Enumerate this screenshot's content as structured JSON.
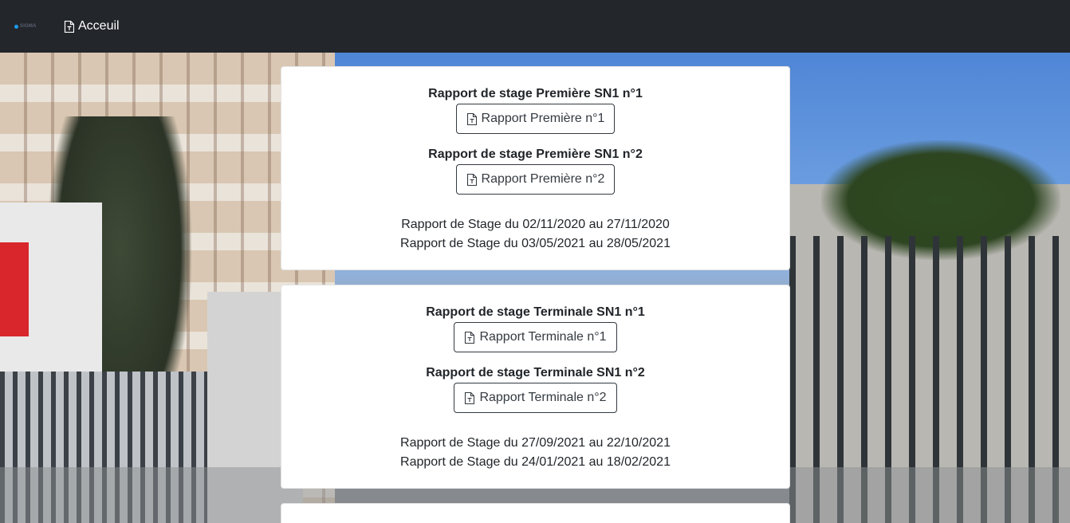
{
  "navbar": {
    "brand_text": "SIGMA",
    "home_label": "Acceuil",
    "home_icon": "file-text-icon"
  },
  "cards": [
    {
      "reports": [
        {
          "title": "Rapport de stage Première SN1 n°1",
          "button": "Rapport Première n°1"
        },
        {
          "title": "Rapport de stage Première SN1 n°2",
          "button": "Rapport Première n°2"
        }
      ],
      "dates": [
        "Rapport de Stage du 02/11/2020 au 27/11/2020",
        "Rapport de Stage du 03/05/2021 au 28/05/2021"
      ]
    },
    {
      "reports": [
        {
          "title": "Rapport de stage Terminale SN1 n°1",
          "button": "Rapport Terminale n°1"
        },
        {
          "title": "Rapport de stage Terminale SN1 n°2",
          "button": "Rapport Terminale n°2"
        }
      ],
      "dates": [
        "Rapport de Stage du 27/09/2021 au 22/10/2021",
        "Rapport de Stage du 24/01/2021 au 18/02/2021"
      ]
    }
  ],
  "colors": {
    "navbar_bg": "#23262b",
    "brand_accent": "#1d9bf0",
    "card_bg": "#ffffff",
    "button_border": "#343a40"
  }
}
